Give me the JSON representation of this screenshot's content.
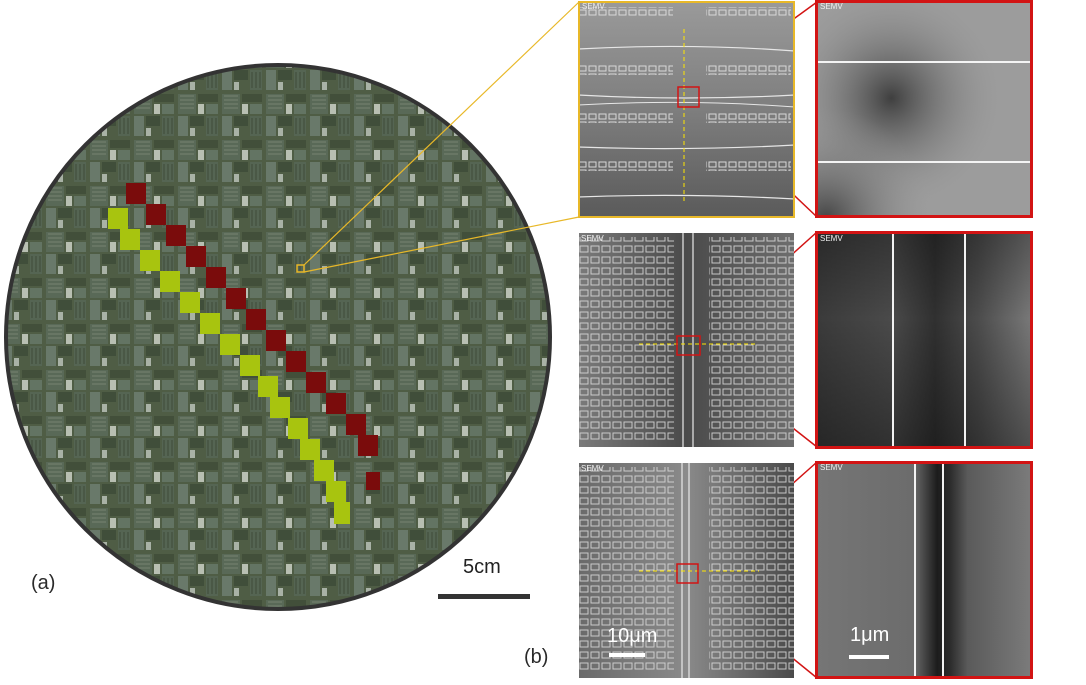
{
  "figure": {
    "panel_a_label": "(a)",
    "panel_b_label": "(b)",
    "wafer_scale_label": "5cm",
    "sem_scale_left_label": "10μm",
    "sem_scale_right_label": "1μm",
    "sem_watermark": "SEMV",
    "colors": {
      "wafer_edge": "#333333",
      "wafer_base": "#4d5a40",
      "red_diagonal": "#7a0c0c",
      "yellow_diagonal": "#a8c40f",
      "zoom_yellow": "#e8b828",
      "zoom_red": "#d21414"
    }
  }
}
